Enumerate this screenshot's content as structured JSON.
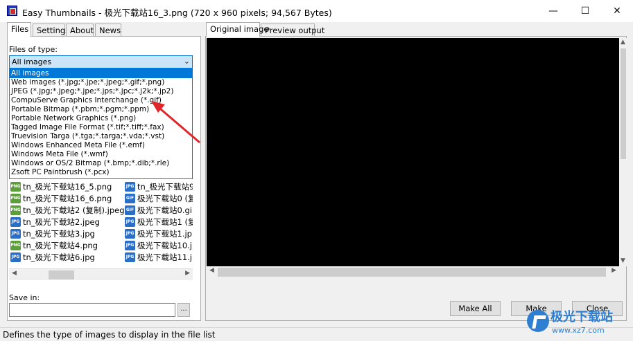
{
  "window": {
    "title": "Easy Thumbnails - 极光下载站16_3.png  (720 x 960 pixels;  94,567 Bytes)",
    "minimize_glyph": "—",
    "maximize_glyph": "☐",
    "close_glyph": "✕"
  },
  "left_tabs": [
    "Files",
    "Settings",
    "About",
    "News"
  ],
  "files_of_type": {
    "label": "Files of type:",
    "selected": "All images",
    "arrow": "⌄",
    "options": [
      "All images",
      "Web images (*.jpg;*.jpe;*.jpeg;*.gif;*.png)",
      "JPEG (*.jpg;*.jpeg;*.jpe;*.jps;*.jpc;*.j2k;*.jp2)",
      "CompuServe Graphics Interchange (*.gif)",
      "Portable Bitmap (*.pbm;*.pgm;*.ppm)",
      "Portable Network Graphics (*.png)",
      "Tagged Image File Format (*.tif;*.tiff;*.fax)",
      "Truevision Targa (*.tga;*.targa;*.vda;*.vst)",
      "Windows Enhanced Meta File (*.emf)",
      "Windows Meta File (*.wmf)",
      "Windows or OS/2 Bitmap (*.bmp;*.dib;*.rle)",
      "Zsoft PC Paintbrush (*.pcx)"
    ]
  },
  "files": {
    "col1": [
      {
        "name": "tn_极光下载站16_5.png",
        "type": "png",
        "icon": "PNG"
      },
      {
        "name": "tn_极光下载站16_6.png",
        "type": "png",
        "icon": "PNG"
      },
      {
        "name": "tn_极光下载站2 (复制).jpeg",
        "type": "png",
        "icon": "PNG"
      },
      {
        "name": "tn_极光下载站2.jpeg",
        "type": "jpg",
        "icon": "JPG"
      },
      {
        "name": "tn_极光下载站3.jpg",
        "type": "jpg",
        "icon": "JPG"
      },
      {
        "name": "tn_极光下载站4.png",
        "type": "png",
        "icon": "PNG"
      },
      {
        "name": "tn_极光下载站6.jpg",
        "type": "jpg",
        "icon": "JPG"
      }
    ],
    "col2": [
      {
        "name": "tn_极光下载站9",
        "type": "jpg",
        "icon": "JPG"
      },
      {
        "name": "极光下载站0 (复",
        "type": "gif",
        "icon": "GIF"
      },
      {
        "name": "极光下载站0.gi",
        "type": "gif",
        "icon": "GIF"
      },
      {
        "name": "极光下载站1 (复",
        "type": "jpg",
        "icon": "JPG"
      },
      {
        "name": "极光下载站1.jp",
        "type": "jpg",
        "icon": "JPG"
      },
      {
        "name": "极光下载站10.j",
        "type": "jpg",
        "icon": "JPG"
      },
      {
        "name": "极光下载站11.j",
        "type": "jpg",
        "icon": "JPG"
      }
    ]
  },
  "save_in": {
    "label": "Save in:",
    "value": "",
    "browse_label": "..."
  },
  "right_tabs": [
    "Original image",
    "Preview output"
  ],
  "buttons": {
    "make_all": "Make All",
    "make": "Make",
    "close": "Close"
  },
  "scroll_arrows": {
    "left": "◀",
    "right": "▶",
    "up": "▲",
    "down": "▼"
  },
  "statusbar": {
    "text": "Defines the type of images to display in the file list"
  },
  "watermark": {
    "main": "极光下载站",
    "sub": "www.xz7.com"
  },
  "annotation": {
    "arrow_color": "#e0262b"
  }
}
